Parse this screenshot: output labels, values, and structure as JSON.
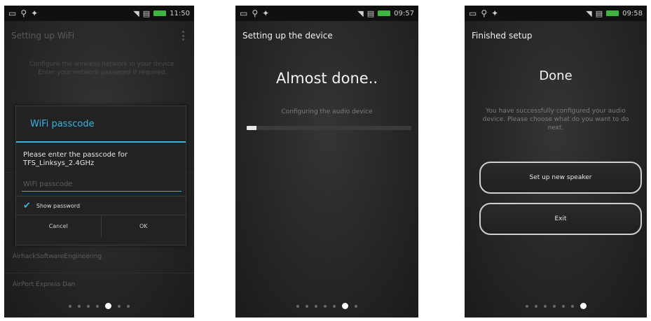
{
  "colors": {
    "accent": "#35b5e5",
    "battery": "#3fb640"
  },
  "screens": [
    {
      "status": {
        "time": "11:50"
      },
      "title": "Setting up WiFi",
      "intro": "Configure the wireless network in your device. Enter your network password if required.",
      "background_items": [
        "AirhackSoftwareEngineering",
        "AirPort Express Dan"
      ],
      "dialog": {
        "title": "WiFi passcode",
        "message": "Please enter the passcode for TFS_Linksys_2.4GHz",
        "input_placeholder": "WiFi passcode",
        "show_password": "Show password",
        "cancel": "Cancel",
        "ok": "OK"
      },
      "page_dots": {
        "count": 7,
        "active": 4
      }
    },
    {
      "status": {
        "time": "09:57"
      },
      "title": "Setting up the device",
      "heading": "Almost done..",
      "status_text": "Configuring the audio device",
      "progress": 0.06,
      "page_dots": {
        "count": 7,
        "active": 5
      }
    },
    {
      "status": {
        "time": "09:58"
      },
      "title": "Finished setup",
      "heading": "Done",
      "message": "You have successfully configured your audio device. Please choose what do you want to do next.",
      "buttons": {
        "new_speaker": "Set up new speaker",
        "exit": "Exit"
      },
      "page_dots": {
        "count": 7,
        "active": 6
      }
    }
  ]
}
